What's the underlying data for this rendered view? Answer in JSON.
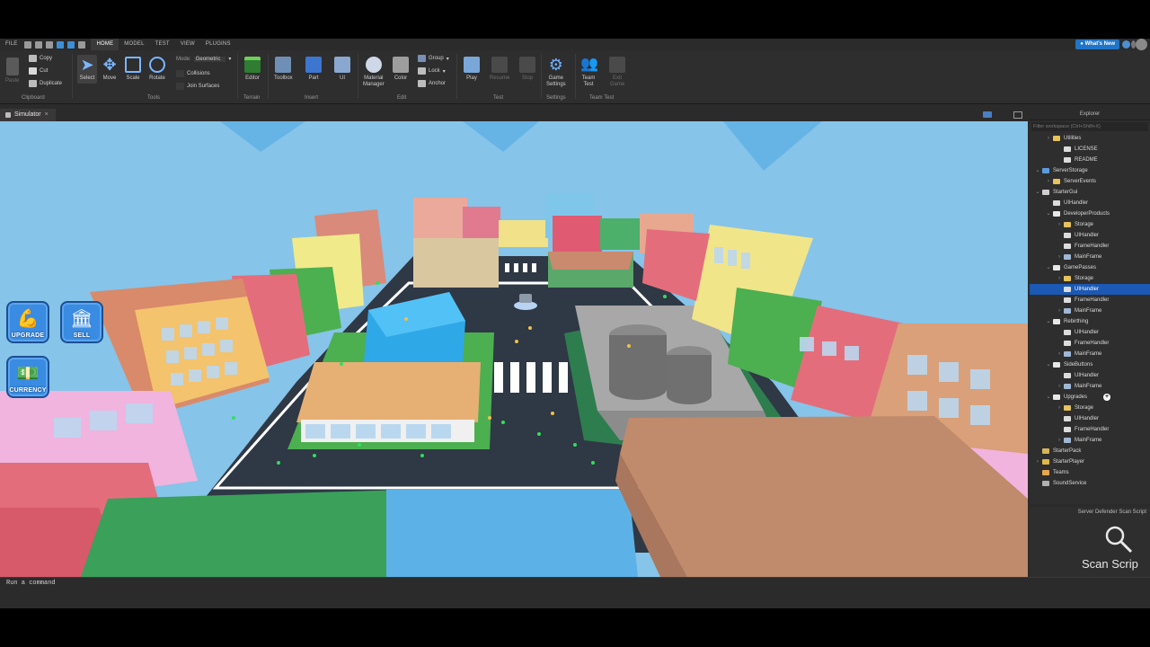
{
  "menubar": {
    "file": "FILE",
    "tabs": [
      "HOME",
      "MODEL",
      "TEST",
      "VIEW",
      "PLUGINS"
    ],
    "active_tab": "HOME",
    "whats_new": "What's New"
  },
  "ribbon": {
    "clipboard": {
      "paste": "Paste",
      "copy": "Copy",
      "cut": "Cut",
      "duplicate": "Duplicate",
      "group": "Clipboard"
    },
    "tools": {
      "select": "Select",
      "move": "Move",
      "scale": "Scale",
      "rotate": "Rotate",
      "mode_label": "Mode:",
      "mode_value": "Geometric",
      "collisions": "Collisions",
      "join_surfaces": "Join Surfaces",
      "group": "Tools"
    },
    "terrain": {
      "editor": "Editor",
      "group": "Terrain"
    },
    "insert": {
      "toolbox": "Toolbox",
      "part": "Part",
      "ui": "UI",
      "group": "Insert"
    },
    "edit": {
      "material_manager": "Material\nManager",
      "color": "Color",
      "group_btn": "Group",
      "lock": "Lock",
      "anchor": "Anchor",
      "group": "Edit"
    },
    "test": {
      "play": "Play",
      "resume": "Resume",
      "stop": "Stop",
      "group": "Test"
    },
    "settings": {
      "game_settings": "Game\nSettings",
      "group": "Settings"
    },
    "team_test": {
      "team_test": "Team\nTest",
      "exit_game": "Exit\nGame",
      "group": "Team Test"
    }
  },
  "doc_tab": {
    "label": "Simulator",
    "close": "×"
  },
  "game_gui": {
    "upgrade": "UPGRADE",
    "sell": "SELL",
    "currency": "CURRENCY"
  },
  "explorer": {
    "title": "Explorer",
    "filter_placeholder": "Filter workspace (Ctrl+Shift+X)",
    "items": [
      {
        "label": "Utilities",
        "depth": 1,
        "chev": "›",
        "icon": "folder"
      },
      {
        "label": "LICENSE",
        "depth": 2,
        "chev": "",
        "icon": "script"
      },
      {
        "label": "README",
        "depth": 2,
        "chev": "",
        "icon": "script"
      },
      {
        "label": "ServerStorage",
        "depth": 0,
        "chev": "⌄",
        "icon": "service"
      },
      {
        "label": "ServerEvents",
        "depth": 1,
        "chev": "›",
        "icon": "folder"
      },
      {
        "label": "StarterGui",
        "depth": 0,
        "chev": "⌄",
        "icon": "gui"
      },
      {
        "label": "UIHandler",
        "depth": 1,
        "chev": "",
        "icon": "script"
      },
      {
        "label": "DeveloperProducts",
        "depth": 1,
        "chev": "⌄",
        "icon": "screengui"
      },
      {
        "label": "Storage",
        "depth": 2,
        "chev": "›",
        "icon": "folder"
      },
      {
        "label": "UIHandler",
        "depth": 2,
        "chev": "",
        "icon": "script"
      },
      {
        "label": "FrameHandler",
        "depth": 2,
        "chev": "",
        "icon": "script"
      },
      {
        "label": "MainFrame",
        "depth": 2,
        "chev": "›",
        "icon": "frame"
      },
      {
        "label": "GamePasses",
        "depth": 1,
        "chev": "⌄",
        "icon": "screengui"
      },
      {
        "label": "Storage",
        "depth": 2,
        "chev": "›",
        "icon": "folder"
      },
      {
        "label": "UIHandler",
        "depth": 2,
        "chev": "",
        "icon": "script",
        "selected": true
      },
      {
        "label": "FrameHandler",
        "depth": 2,
        "chev": "",
        "icon": "script"
      },
      {
        "label": "MainFrame",
        "depth": 2,
        "chev": "›",
        "icon": "frame"
      },
      {
        "label": "Rebirthing",
        "depth": 1,
        "chev": "⌄",
        "icon": "screengui"
      },
      {
        "label": "UIHandler",
        "depth": 2,
        "chev": "",
        "icon": "script"
      },
      {
        "label": "FrameHandler",
        "depth": 2,
        "chev": "",
        "icon": "script"
      },
      {
        "label": "MainFrame",
        "depth": 2,
        "chev": "›",
        "icon": "frame"
      },
      {
        "label": "SideButtons",
        "depth": 1,
        "chev": "⌄",
        "icon": "screengui"
      },
      {
        "label": "UIHandler",
        "depth": 2,
        "chev": "",
        "icon": "script"
      },
      {
        "label": "MainFrame",
        "depth": 2,
        "chev": "›",
        "icon": "frame"
      },
      {
        "label": "Upgrades",
        "depth": 1,
        "chev": "⌄",
        "icon": "screengui",
        "add": true
      },
      {
        "label": "Storage",
        "depth": 2,
        "chev": "›",
        "icon": "folder"
      },
      {
        "label": "UIHandler",
        "depth": 2,
        "chev": "",
        "icon": "script"
      },
      {
        "label": "FrameHandler",
        "depth": 2,
        "chev": "",
        "icon": "script"
      },
      {
        "label": "MainFrame",
        "depth": 2,
        "chev": "›",
        "icon": "frame"
      },
      {
        "label": "StarterPack",
        "depth": 0,
        "chev": "",
        "icon": "pack"
      },
      {
        "label": "StarterPlayer",
        "depth": 0,
        "chev": "›",
        "icon": "player"
      },
      {
        "label": "Teams",
        "depth": 0,
        "chev": "",
        "icon": "teams"
      },
      {
        "label": "SoundService",
        "depth": 0,
        "chev": "",
        "icon": "sound"
      }
    ]
  },
  "scan_panel": {
    "title": "Server Defender Scan Script",
    "label": "Scan Scrip"
  },
  "command_bar": {
    "placeholder": "Run a command"
  },
  "colors": {
    "accent": "#1f74c8",
    "selection": "#1b59b5",
    "sky": "#86c4e9",
    "road": "#2f3845",
    "gui_button": "#3a8be2"
  }
}
